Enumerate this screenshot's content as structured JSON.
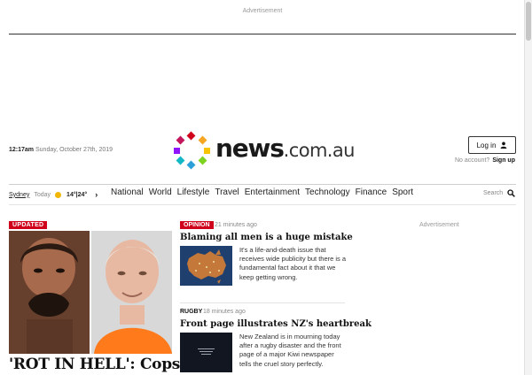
{
  "ads": {
    "top_label": "Advertisement",
    "right_label": "Advertisement"
  },
  "header": {
    "time": "12:17am",
    "date": "Sunday, October 27th, 2019",
    "logo": {
      "brand": "news",
      "tld": ".com.au"
    },
    "login_label": "Log in",
    "no_account_text": "No account?",
    "signup_label": "Sign up"
  },
  "weather": {
    "city": "Sydney",
    "day": "Today",
    "temps": "14°|24°",
    "icon": "sun-icon"
  },
  "nav": {
    "items": [
      "National",
      "World",
      "Lifestyle",
      "Travel",
      "Entertainment",
      "Technology",
      "Finance",
      "Sport"
    ],
    "search_label": "Search"
  },
  "lead": {
    "badge": "UPDATED",
    "headline": "'ROT IN HELL': Cops get"
  },
  "stories": [
    {
      "tag": "OPINION",
      "time": "21 minutes ago",
      "title": "Blaming all men is a huge mistake",
      "blurb": "It's a life-and-death issue that receives wide publicity but there is a fundamental fact about it that we keep getting wrong."
    },
    {
      "tag": "RUGBY",
      "time": "18 minutes ago",
      "title": "Front page illustrates NZ's heartbreak",
      "blurb": "New Zealand is in mourning today after a rugby disaster and the front page of a major Kiwi newspaper tells the cruel story perfectly."
    }
  ],
  "colors": {
    "brand_red": "#d0021b",
    "text": "#111111",
    "muted": "#888888"
  }
}
